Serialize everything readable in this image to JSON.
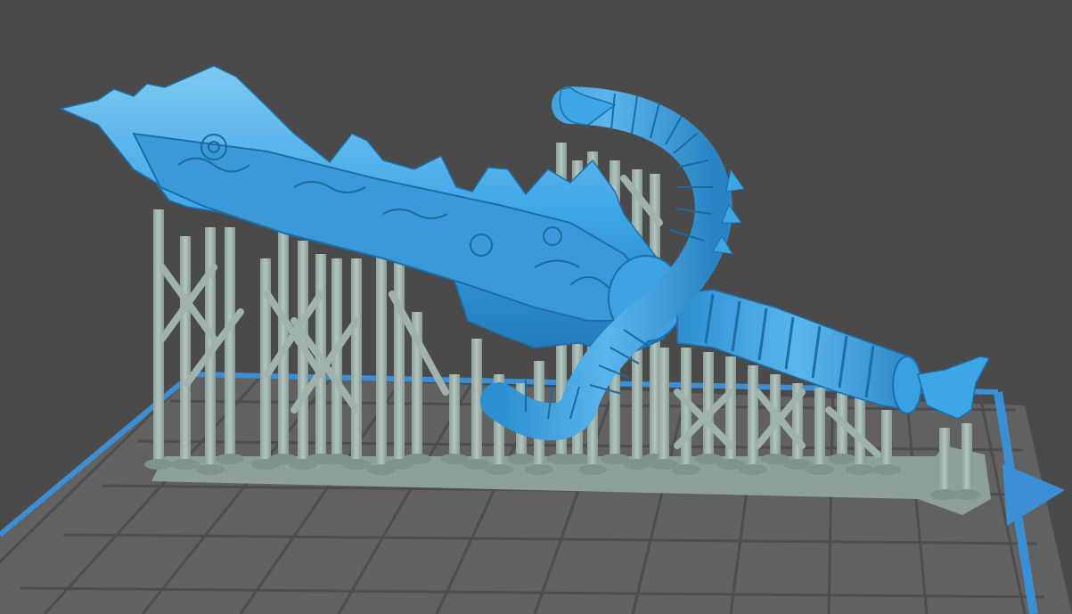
{
  "viewport": {
    "background": "#4a4a4a",
    "build_plate": {
      "fill": "#616161",
      "grid_line": "#4d4d4d",
      "edge": "#3c8fd4"
    },
    "support": {
      "color": "#9fb3ac",
      "shade": "#7f938c",
      "raft_color": "#8fa39c"
    },
    "model": {
      "color": "#3fa6e6",
      "shade": "#1f78b8",
      "highlight": "#7ec9f2"
    },
    "icons": [
      "build-plate-icon",
      "axis-arrow-icon"
    ]
  }
}
